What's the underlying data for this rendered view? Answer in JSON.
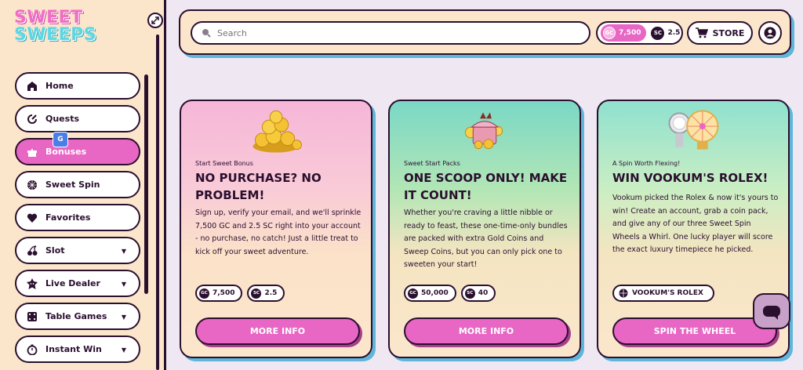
{
  "brand": {
    "line1": "SWEET",
    "line2": "SWEEPS"
  },
  "sidebar": {
    "items": [
      {
        "label": "Home",
        "icon": "home-icon",
        "dropdown": false
      },
      {
        "label": "Quests",
        "icon": "quests-icon",
        "dropdown": false
      },
      {
        "label": "Bonuses",
        "icon": "gift-icon",
        "dropdown": false,
        "active": true
      },
      {
        "label": "Sweet Spin",
        "icon": "spin-icon",
        "dropdown": false
      },
      {
        "label": "Favorites",
        "icon": "heart-icon",
        "dropdown": false
      },
      {
        "label": "Slot",
        "icon": "cherry-icon",
        "dropdown": true
      },
      {
        "label": "Live Dealer",
        "icon": "dealer-icon",
        "dropdown": true
      },
      {
        "label": "Table Games",
        "icon": "dice-icon",
        "dropdown": true
      },
      {
        "label": "Instant Win",
        "icon": "stopwatch-icon",
        "dropdown": true
      }
    ],
    "caret": "▼"
  },
  "header": {
    "search_placeholder": "Search",
    "gc_label": "GC",
    "gc_amount": "7,500",
    "sc_label": "SC",
    "sc_amount": "2.5",
    "store_label": "STORE"
  },
  "cards": [
    {
      "kicker": "Start Sweet Bonus",
      "title": "NO PURCHASE? NO PROBLEM!",
      "body": "Sign up, verify your email, and we'll sprinkle 7,500 GC and 2.5 SC right into your account - no purchase, no catch! Just a little treat to kick off your sweet adventure.",
      "pills": [
        {
          "coin": "GC",
          "value": "7,500"
        },
        {
          "coin": "SC",
          "value": "2.5"
        }
      ],
      "cta": "MORE INFO"
    },
    {
      "kicker": "Sweet Start Packs",
      "title": "ONE SCOOP ONLY! MAKE IT COUNT!",
      "body": "Whether you're craving a little nibble or ready to feast, these one-time-only bundles are packed with extra Gold Coins and Sweep Coins, but you can only pick one to sweeten your start!",
      "pills": [
        {
          "coin": "GC",
          "value": "50,000"
        },
        {
          "coin": "SC",
          "value": "40"
        }
      ],
      "cta": "MORE INFO"
    },
    {
      "kicker": "A Spin Worth Flexing!",
      "title": "WIN VOOKUM'S ROLEX!",
      "body": "Vookum picked the Rolex & now it's yours to win! Create an account, grab a coin pack, and give any of our three Sweet Spin Wheels a Whirl. One lucky player will score the exact luxury timepiece he picked.",
      "pill_label": "VOOKUM'S ROLEX",
      "cta": "SPIN THE WHEEL"
    }
  ],
  "colors": {
    "accent": "#e866c4",
    "dark": "#2a0f2e",
    "cream": "#fbe6cc",
    "shadow": "#5fb6d9"
  }
}
